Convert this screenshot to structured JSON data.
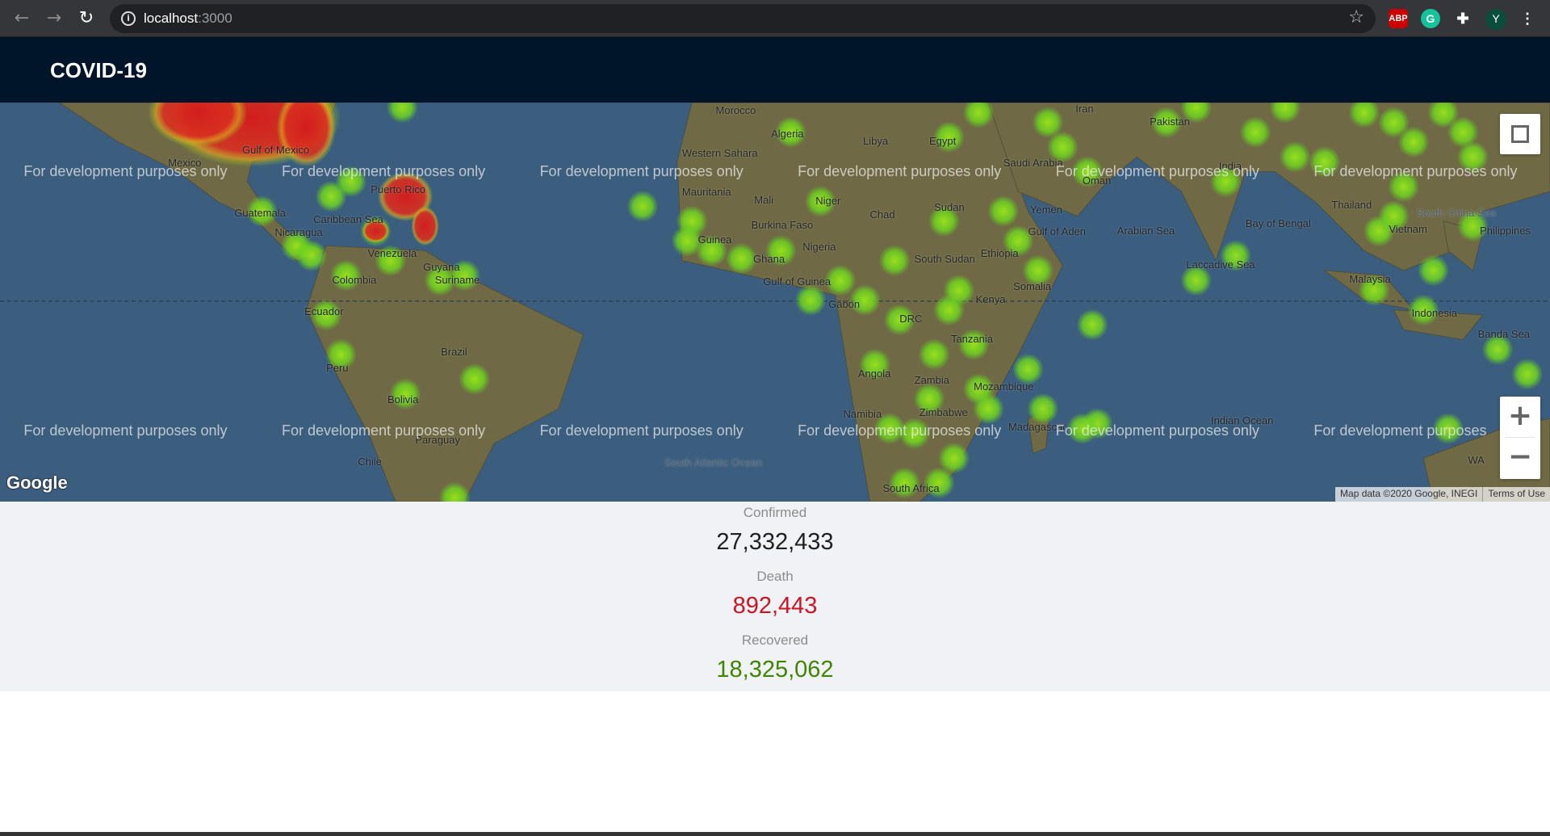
{
  "browser": {
    "url_host": "localhost",
    "url_port": ":3000",
    "extensions": [
      "ABP",
      "G",
      "puzzle",
      "Y"
    ],
    "profile_initial": "Y"
  },
  "header": {
    "title": "COVID-19"
  },
  "map": {
    "watermark": "For development purposes only",
    "watermark_cut": "For development purposes",
    "logo": "Google",
    "attribution": "Map data ©2020 Google, INEGI",
    "terms": "Terms of Use",
    "zoom_in": "+",
    "zoom_out": "−",
    "labels": [
      "Mexico",
      "Gulf of Mexico",
      "Guatemala",
      "Caribbean Sea",
      "Nicaragua",
      "Puerto Rico",
      "Venezuela",
      "Colombia",
      "Guyana",
      "Suriname",
      "Ecuador",
      "Peru",
      "Brazil",
      "Bolivia",
      "Paraguay",
      "Chile",
      "South Atlantic Ocean",
      "Morocco",
      "Algeria",
      "Libya",
      "Egypt",
      "Western Sahara",
      "Mauritania",
      "Mali",
      "Niger",
      "Chad",
      "Sudan",
      "Burkina Faso",
      "Guinea",
      "Ghana",
      "Nigeria",
      "Gulf of Guinea",
      "Gabon",
      "South Sudan",
      "Ethiopia",
      "Somalia",
      "Kenya",
      "DRC",
      "Tanzania",
      "Angola",
      "Zambia",
      "Mozambique",
      "Namibia",
      "Zimbabwe",
      "Madagascar",
      "South Africa",
      "Iran",
      "Saudi Arabia",
      "Yemen",
      "Oman",
      "Gulf of Aden",
      "Pakistan",
      "India",
      "Arabian Sea",
      "Bay of Bengal",
      "Laccadive Sea",
      "Thailand",
      "Vietnam",
      "Philippines",
      "Malaysia",
      "Indonesia",
      "South China Sea",
      "Banda Sea",
      "WA",
      "Indian Ocean"
    ],
    "colors": {
      "water": "#3b5d7e",
      "land": "#6f6a45",
      "heat_low": "#7fe01f",
      "heat_high": "#d42020"
    }
  },
  "stats": {
    "confirmed_label": "Confirmed",
    "confirmed_value": "27,332,433",
    "death_label": "Death",
    "death_value": "892,443",
    "recovered_label": "Recovered",
    "recovered_value": "18,325,062",
    "colors": {
      "confirmed": "#1f1f1f",
      "death": "#cf1322",
      "recovered": "#3f8600"
    }
  }
}
